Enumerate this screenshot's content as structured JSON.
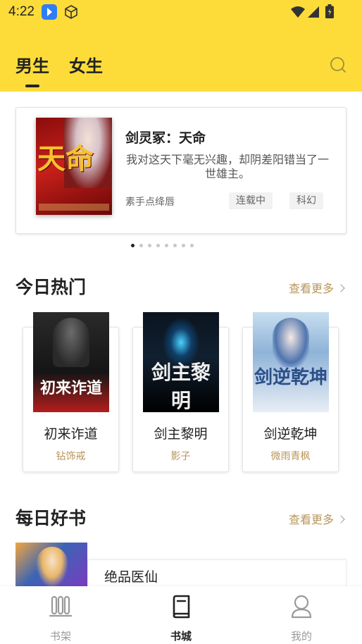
{
  "status_bar": {
    "time": "4:22"
  },
  "top_tabs": [
    {
      "label": "男生",
      "active": true
    },
    {
      "label": "女生",
      "active": false
    }
  ],
  "banner": {
    "cover_text": "天命",
    "title": "剑灵冢：天命",
    "description": "我对这天下毫无兴趣，却阴差阳错当了一世雄主。",
    "author": "素手点绛唇",
    "tags": [
      "连载中",
      "科幻"
    ],
    "page_count": 8,
    "current_page": 1
  },
  "hot_today": {
    "title": "今日热门",
    "more_label": "查看更多",
    "books": [
      {
        "name": "初来诈道",
        "author": "钻饰戒",
        "cover_text": "初来诈道"
      },
      {
        "name": "剑主黎明",
        "author": "影子",
        "cover_text": "剑主黎明"
      },
      {
        "name": "剑逆乾坤",
        "author": "微雨青枫",
        "cover_text": "剑逆乾坤"
      }
    ]
  },
  "daily_books": {
    "title": "每日好书",
    "more_label": "查看更多",
    "items": [
      {
        "name": "绝品医仙"
      }
    ]
  },
  "bottom_nav": [
    {
      "label": "书架",
      "icon": "bookshelf-icon",
      "active": false
    },
    {
      "label": "书城",
      "icon": "book-icon",
      "active": true
    },
    {
      "label": "我的",
      "icon": "profile-icon",
      "active": false
    }
  ],
  "colors": {
    "header_bg": "#fddc3a",
    "accent_gold": "#b8965a",
    "active_text": "#222222",
    "inactive_text": "#9a9a9a"
  }
}
